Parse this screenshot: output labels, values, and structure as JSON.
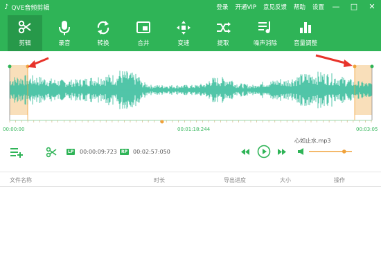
{
  "app": {
    "title": "QVE音频剪辑"
  },
  "header_links": [
    "登录",
    "开通VIP",
    "意见反馈",
    "帮助",
    "设置"
  ],
  "window_controls": {
    "min": "—",
    "max": "□",
    "close": "✕"
  },
  "tools": [
    {
      "label": "剪辑",
      "icon": "scissors-icon",
      "active": true
    },
    {
      "label": "录音",
      "icon": "microphone-icon",
      "active": false
    },
    {
      "label": "转换",
      "icon": "convert-arrows-icon",
      "active": false
    },
    {
      "label": "合并",
      "icon": "merge-icon",
      "active": false
    },
    {
      "label": "变速",
      "icon": "speed-icon",
      "active": false
    },
    {
      "label": "提取",
      "icon": "extract-icon",
      "active": false
    },
    {
      "label": "噪声消除",
      "icon": "noise-reduction-icon",
      "active": false
    },
    {
      "label": "音量调整",
      "icon": "volume-bars-icon",
      "active": false
    }
  ],
  "timeline": {
    "start": "00:00:00",
    "middle": "00:01:18:244",
    "end": "00:03:05"
  },
  "editor": {
    "lp_tag": "LP",
    "lp_time": "00:00:09:723",
    "rp_tag": "RP",
    "rp_time": "00:02:57:050",
    "filename": "心如止水.mp3",
    "volume_level": 0.82
  },
  "table": {
    "columns": [
      "文件名称",
      "时长",
      "导出进度",
      "大小",
      "操作"
    ]
  },
  "colors": {
    "brand": "#2fb457",
    "brand_dark": "#27994a",
    "wave": "#3ebf9f",
    "selection": "#f9dfba",
    "marker": "#f0a23a",
    "arrow": "#e8332a"
  }
}
